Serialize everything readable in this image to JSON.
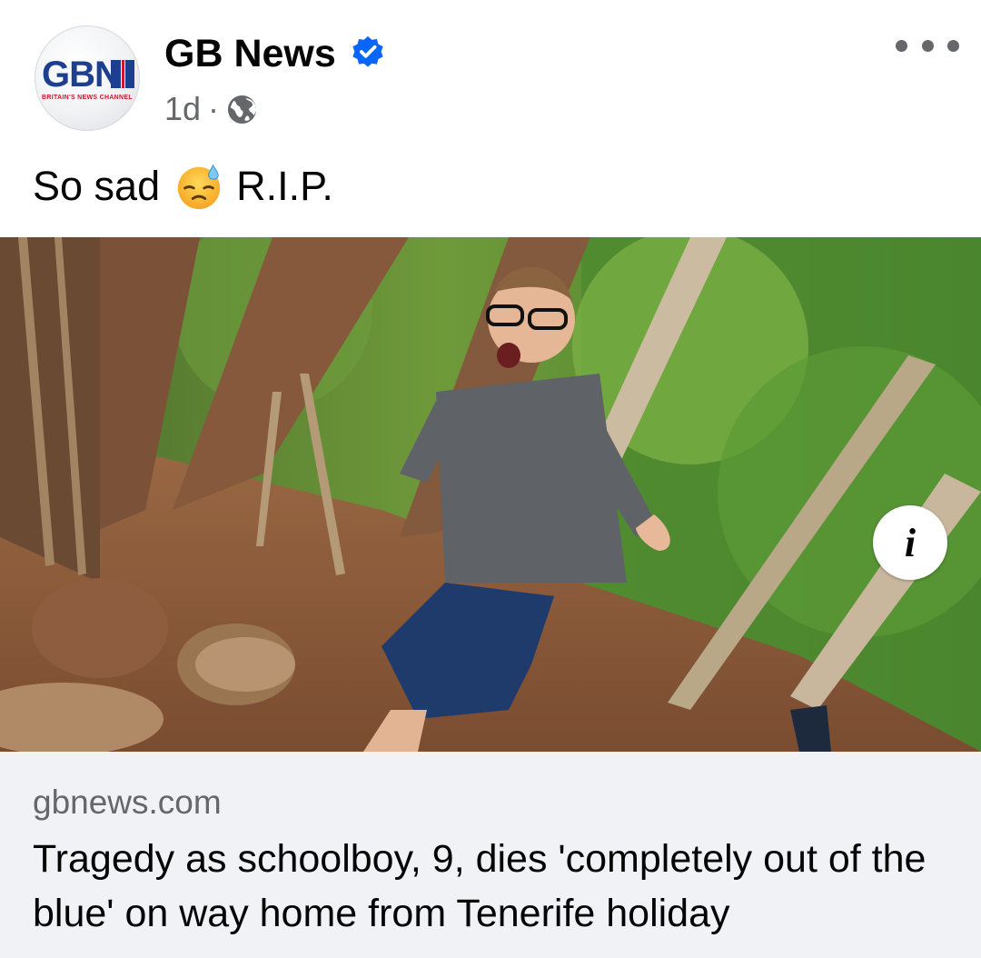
{
  "post": {
    "page_name": "GB News",
    "verified": true,
    "time": "1d",
    "separator": "·",
    "audience_icon": "globe-icon",
    "more_icon": "more-options-icon",
    "avatar": {
      "logo_text": "GBN",
      "tagline": "BRITAIN'S NEWS CHANNEL"
    },
    "text": "So sad",
    "emoji": "downcast-face-with-sweat-icon",
    "text_after": "R.I.P."
  },
  "link_card": {
    "domain": "gbnews.com",
    "title": "Tragedy as schoolboy, 9, dies 'completely out of the blue' on way home from Tenerife holiday",
    "info_label": "i"
  },
  "colors": {
    "verified_blue": "#0866ff",
    "secondary_text": "#65676b",
    "card_bg": "#f0f2f5",
    "brand_blue": "#1c3f8f",
    "brand_red": "#d0142c"
  }
}
